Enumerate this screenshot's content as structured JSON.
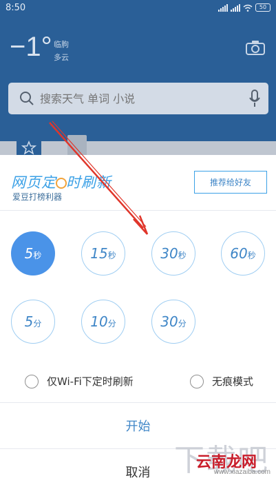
{
  "status_bar": {
    "time": "8:50",
    "battery": "50"
  },
  "weather": {
    "temperature": "−1°",
    "location_line": "临朐",
    "condition": "多云"
  },
  "search": {
    "placeholder": "搜索天气 单词 小说"
  },
  "dialog": {
    "logo_title_before": "网页定",
    "logo_title_after": "时刷新",
    "logo_subtitle": "爱豆打榜利器",
    "recommend_label": "推荐给好友",
    "interval_options": [
      {
        "num": "5",
        "unit": "秒",
        "selected": true
      },
      {
        "num": "15",
        "unit": "秒",
        "selected": false
      },
      {
        "num": "30",
        "unit": "秒",
        "selected": false
      },
      {
        "num": "60",
        "unit": "秒",
        "selected": false
      },
      {
        "num": "5",
        "unit": "分",
        "selected": false
      },
      {
        "num": "10",
        "unit": "分",
        "selected": false
      },
      {
        "num": "30",
        "unit": "分",
        "selected": false
      }
    ],
    "wifi_only_label": "仅Wi-Fi下定时刷新",
    "incognito_label": "无痕模式",
    "start_label": "开始",
    "cancel_label": "取消"
  },
  "watermark": {
    "faint_text": "下载吧",
    "logo_text": "云南龙网",
    "url_text": "www.xiazaiba.com"
  },
  "colors": {
    "accent": "#4a93e8",
    "header_bg": "#2a5f97",
    "arrow": "#e0362b"
  }
}
